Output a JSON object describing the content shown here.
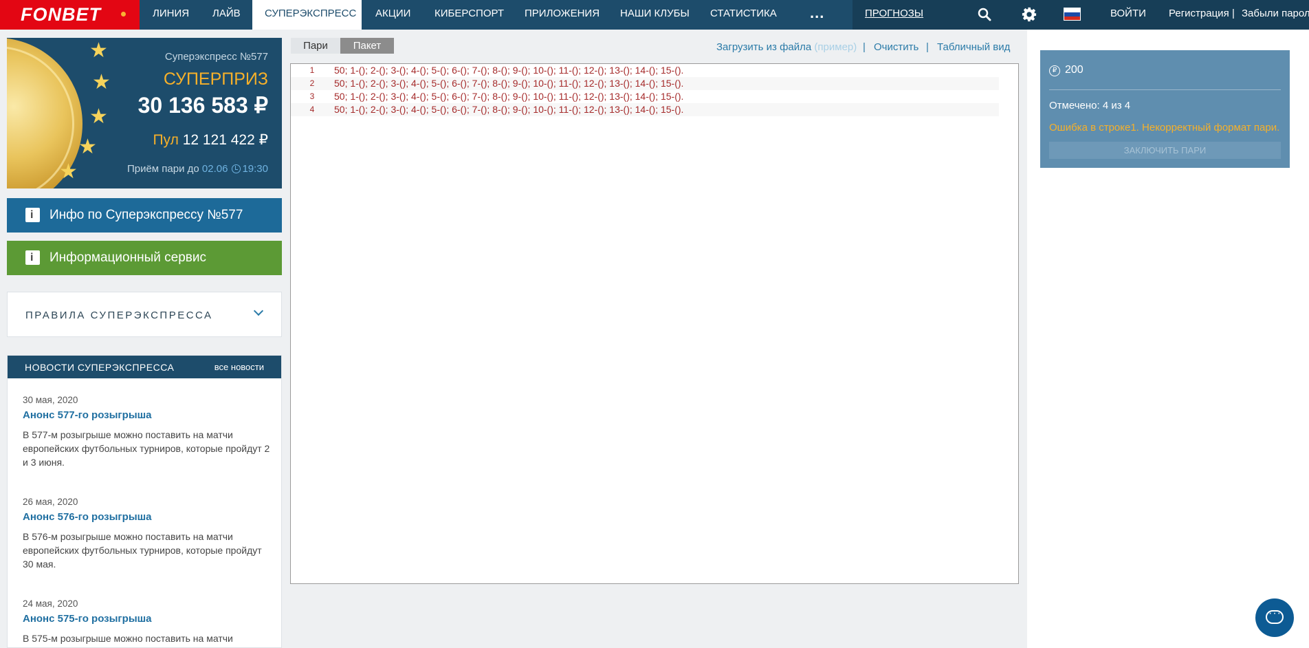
{
  "nav": {
    "logo": "FONBET",
    "items": [
      "ЛИНИЯ",
      "ЛАЙВ",
      "СУПЕРЭКСПРЕСС",
      "АКЦИИ",
      "КИБЕРСПОРТ",
      "ПРИЛОЖЕНИЯ",
      "НАШИ КЛУБЫ",
      "СТАТИСТИКА"
    ],
    "more": "...",
    "prognozy": "ПРОГНОЗЫ",
    "login": "ВОЙТИ",
    "register": "Регистрация",
    "separator": "|",
    "forgot": "Забыли пароль?",
    "colors": {
      "brand_red": "#e30613",
      "navy": "#1d4c6b",
      "accent_orange": "#f6b02a",
      "green": "#5c9a35"
    }
  },
  "banner": {
    "number": "Суперэкспресс №577",
    "prize_label": "СУПЕРПРИЗ",
    "prize_amount": "30 136 583 ₽",
    "pool_label": "Пул",
    "pool_amount": "12 121 422 ₽",
    "accept_label": "Приём пари до",
    "accept_date": "02.06",
    "accept_time": "19:30"
  },
  "buttons": {
    "info_superexpress": "Инфо по Суперэкспрессу №577",
    "info_service": "Информационный сервис"
  },
  "rules": {
    "label": "ПРАВИЛА СУПЕРЭКСПРЕССА"
  },
  "news": {
    "title": "НОВОСТИ СУПЕРЭКСПРЕССА",
    "all": "все новости",
    "items": [
      {
        "date": "30 мая, 2020",
        "title": "Анонс 577-го розыгрыша",
        "text": "В 577-м розыгрыше можно поставить на матчи европейских футбольных турниров, которые пройдут 2 и 3 июня."
      },
      {
        "date": "26 мая, 2020",
        "title": "Анонс 576-го розыгрыша",
        "text": "В 576-м розыгрыше можно поставить на матчи европейских футбольных турниров, которые пройдут 30 мая."
      },
      {
        "date": "24 мая, 2020",
        "title": "Анонс 575-го розыгрыша",
        "text": "В 575-м розыгрыше можно поставить на матчи"
      }
    ]
  },
  "center": {
    "tabs": [
      "Пари",
      "Пакет"
    ],
    "load_file": "Загрузить из файла",
    "example": "(пример)",
    "clear": "Очистить",
    "table_view": "Табличный вид",
    "pipe": "|",
    "lines": [
      {
        "n": "1",
        "text": "50; 1-(); 2-(); 3-(); 4-(); 5-(); 6-(); 7-(); 8-(); 9-(); 10-(); 11-(); 12-(); 13-(); 14-(); 15-()."
      },
      {
        "n": "2",
        "text": "50; 1-(); 2-(); 3-(); 4-(); 5-(); 6-(); 7-(); 8-(); 9-(); 10-(); 11-(); 12-(); 13-(); 14-(); 15-()."
      },
      {
        "n": "3",
        "text": "50; 1-(); 2-(); 3-(); 4-(); 5-(); 6-(); 7-(); 8-(); 9-(); 10-(); 11-(); 12-(); 13-(); 14-(); 15-()."
      },
      {
        "n": "4",
        "text": "50; 1-(); 2-(); 3-(); 4-(); 5-(); 6-(); 7-(); 8-(); 9-(); 10-(); 11-(); 12-(); 13-(); 14-(); 15-()."
      }
    ]
  },
  "right": {
    "ruble": "₽",
    "stake": "200",
    "marked": "Отмечено: 4 из 4",
    "error": "Ошибка в строке1. Некорректный формат пари.",
    "submit": "ЗАКЛЮЧИТЬ ПАРИ"
  }
}
